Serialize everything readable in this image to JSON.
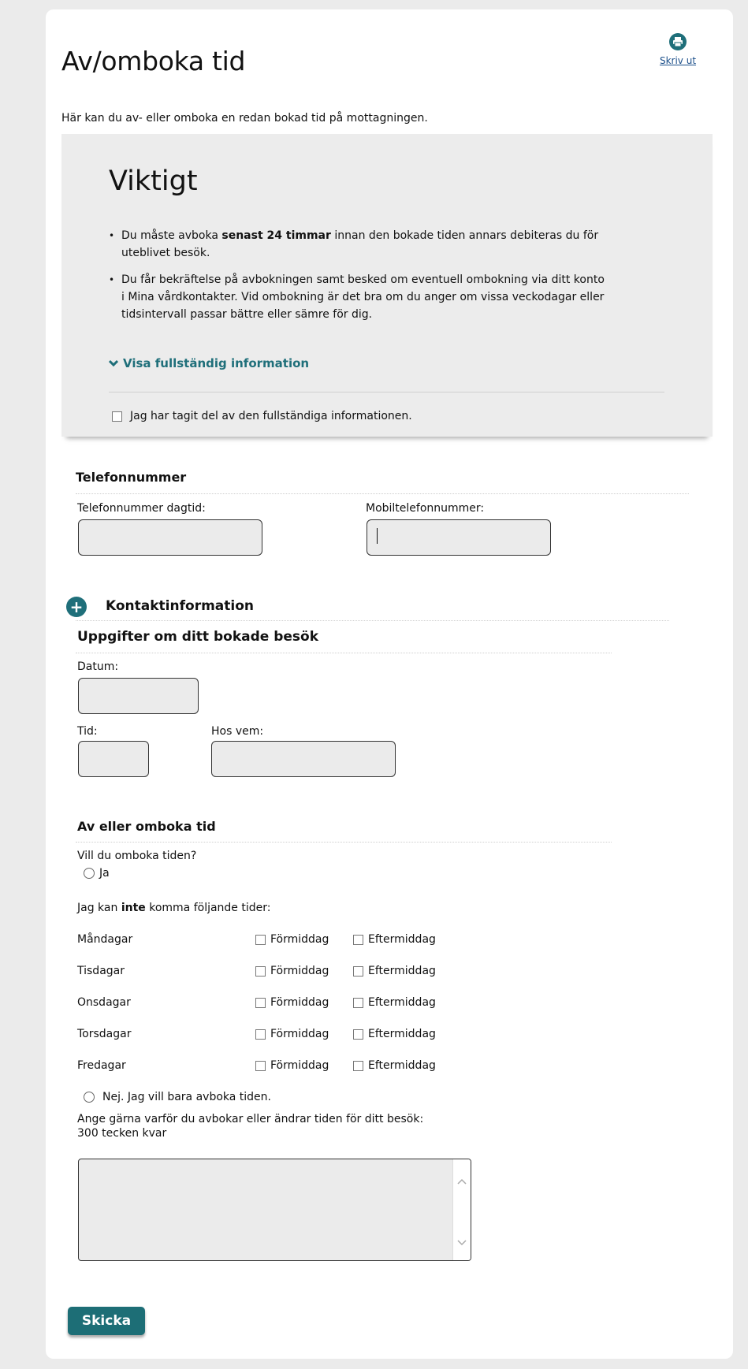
{
  "page": {
    "title": "Av/omboka tid",
    "print_label": "Skriv ut",
    "intro": "Här kan du av- eller omboka en redan bokad tid på mottagningen."
  },
  "important": {
    "title": "Viktigt",
    "bullet1_pre": "Du måste avboka ",
    "bullet1_bold": "senast 24 timmar",
    "bullet1_post": " innan den bokade tiden annars debiteras du för uteblivet besök.",
    "bullet2": "Du får bekräftelse på avbokningen samt besked om eventuell ombokning via ditt konto i Mina vårdkontakter. Vid ombokning är det bra om du anger om vissa veckodagar eller tidsintervall passar bättre eller sämre för dig.",
    "more_label": "Visa fullständig information",
    "confirm_label": "Jag har tagit del av den fullständiga informationen."
  },
  "phone": {
    "heading": "Telefonnummer",
    "day_label": "Telefonnummer dagtid:",
    "mobile_label": "Mobiltelefonnummer:",
    "day_value": "",
    "mobile_value": ""
  },
  "contact": {
    "heading": "Kontaktinformation"
  },
  "visit": {
    "heading": "Uppgifter om ditt bokade besök",
    "date_label": "Datum:",
    "time_label": "Tid:",
    "with_label": "Hos vem:"
  },
  "rebook": {
    "heading": "Av eller omboka tid",
    "question": "Vill du omboka tiden?",
    "yes_label": "Ja",
    "cannot_pre": "Jag kan ",
    "cannot_bold": "inte",
    "cannot_post": " komma följande tider:",
    "morning_label": "Förmiddag",
    "afternoon_label": "Eftermiddag",
    "days": [
      "Måndagar",
      "Tisdagar",
      "Onsdagar",
      "Torsdagar",
      "Fredagar"
    ],
    "no_label": "Nej. Jag vill bara avboka tiden.",
    "reason_label": "Ange gärna varför du avbokar eller ändrar tiden för ditt besök:",
    "chars_left": "300 tecken kvar",
    "reason_value": ""
  },
  "submit_label": "Skicka",
  "colors": {
    "accent": "#1f6f7a",
    "button": "#1d6e76",
    "field_bg": "#ebebeb",
    "panel_bg": "#ececec"
  }
}
